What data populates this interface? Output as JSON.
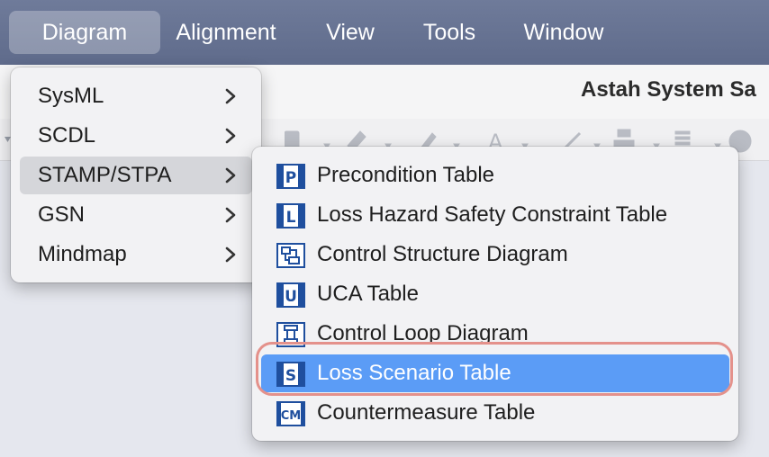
{
  "menubar": {
    "items": [
      {
        "label": "Diagram"
      },
      {
        "label": "Alignment"
      },
      {
        "label": "View"
      },
      {
        "label": "Tools"
      },
      {
        "label": "Window"
      }
    ]
  },
  "window": {
    "title": "Astah System Sa"
  },
  "diagram_menu": {
    "items": [
      {
        "label": "SysML"
      },
      {
        "label": "SCDL"
      },
      {
        "label": "STAMP/STPA"
      },
      {
        "label": "GSN"
      },
      {
        "label": "Mindmap"
      }
    ]
  },
  "stamp_submenu": {
    "items": [
      {
        "label": "Precondition Table",
        "icon_text": "P"
      },
      {
        "label": "Loss Hazard Safety Constraint Table",
        "icon_text": "L"
      },
      {
        "label": "Control Structure Diagram",
        "icon_text": ""
      },
      {
        "label": "UCA Table",
        "icon_text": "U"
      },
      {
        "label": "Control Loop Diagram",
        "icon_text": ""
      },
      {
        "label": "Loss Scenario Table",
        "icon_text": "S"
      },
      {
        "label": "Countermeasure Table",
        "icon_text": "CM"
      }
    ]
  },
  "colors": {
    "menubar": "#66728f",
    "selection": "#5b9cf6",
    "highlight_ring": "#e4918b",
    "icon_blue": "#1f4f9e"
  }
}
